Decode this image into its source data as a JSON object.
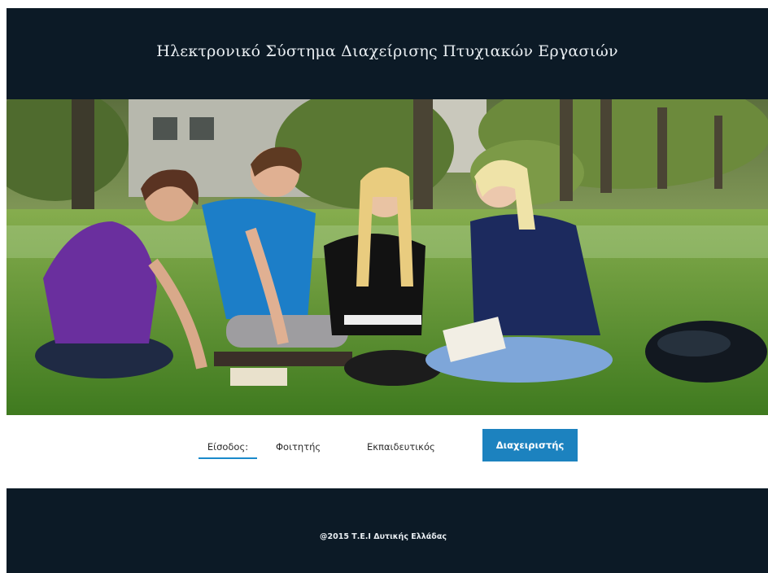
{
  "header": {
    "title": "Ηλεκτρονικό Σύστημα Διαχείρισης Πτυχιακών Εργασιών"
  },
  "hero": {
    "image_description_icon": "students-studying-photo"
  },
  "nav": {
    "tabs": [
      {
        "label": "Είσοδος:"
      },
      {
        "label": "Φοιτητής"
      },
      {
        "label": "Εκπαιδευτικός"
      },
      {
        "label": "Διαχειριστής"
      }
    ]
  },
  "footer": {
    "text": "@2015 Τ.Ε.Ι Δυτικής Ελλάδας"
  },
  "colors": {
    "dark_bar": "#0c1a26",
    "accent": "#1c82bf"
  }
}
